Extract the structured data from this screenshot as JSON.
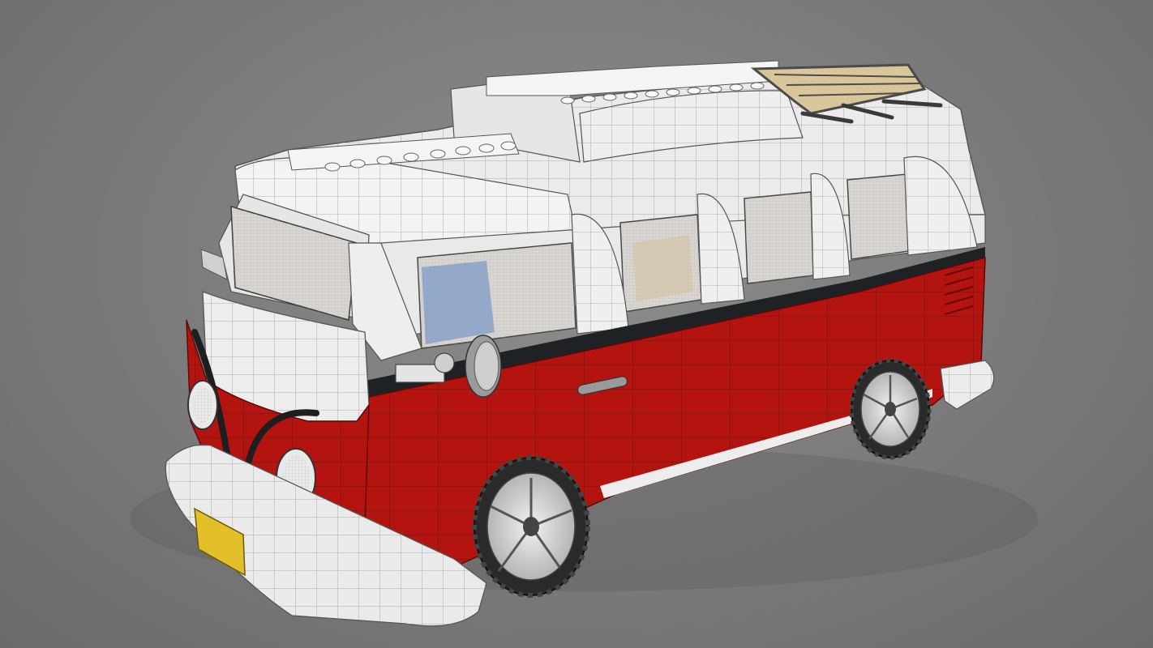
{
  "scene": {
    "subject": "van-model",
    "colors": {
      "background": "#7d7d7d",
      "body_red": "#b3140f",
      "body_red_dark": "#8e0e0b",
      "body_white": "#ececec",
      "body_white_shade": "#cfcfcf",
      "trim_dark": "#1e2224",
      "glass": "#d9d6d2",
      "interior_blue": "#7f9fd1",
      "interior_tan": "#d8c8a8",
      "plate_yellow": "#e3c02a",
      "tire": "#2a2a2a",
      "rim": "#d0d0d0",
      "rack": "#555555"
    },
    "icons": [
      "roof-rack-icon",
      "headlight-icon",
      "wheel-icon",
      "side-mirror-icon",
      "door-handle-icon",
      "license-plate-icon"
    ]
  }
}
